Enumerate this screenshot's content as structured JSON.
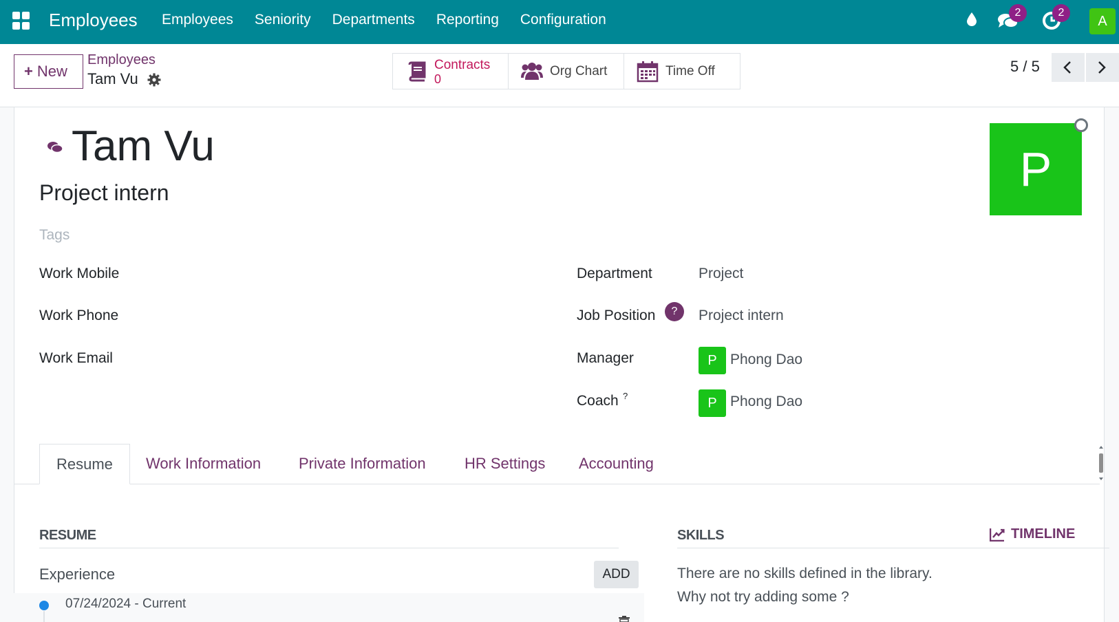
{
  "navbar": {
    "brand": "Employees",
    "menu": [
      "Employees",
      "Seniority",
      "Departments",
      "Reporting",
      "Configuration"
    ],
    "chat_badge": "2",
    "activity_badge": "2",
    "user_initial": "A",
    "color": "#008795"
  },
  "control": {
    "new_label": "New",
    "breadcrumb_parent": "Employees",
    "breadcrumb_current": "Tam Vu",
    "smart_buttons": {
      "contracts_label": "Contracts",
      "contracts_count": "0",
      "org_chart_label": "Org Chart",
      "time_off_label": "Time Off"
    },
    "pager": "5 / 5"
  },
  "employee": {
    "name": "Tam Vu",
    "job_title": "Project intern",
    "tags_placeholder": "Tags",
    "photo_initial": "P",
    "fields_left": {
      "work_mobile_label": "Work Mobile",
      "work_phone_label": "Work Phone",
      "work_email_label": "Work Email"
    },
    "fields_right": {
      "department_label": "Department",
      "department_value": "Project",
      "job_position_label": "Job Position",
      "job_position_help": "?",
      "job_position_value": "Project intern",
      "manager_label": "Manager",
      "manager_initial": "P",
      "manager_value": "Phong Dao",
      "coach_label": "Coach",
      "coach_help": "?",
      "coach_initial": "P",
      "coach_value": "Phong Dao"
    }
  },
  "tabs": [
    "Resume",
    "Work Information",
    "Private Information",
    "HR Settings",
    "Accounting"
  ],
  "resume": {
    "title": "RESUME",
    "experience_label": "Experience",
    "add_label": "ADD",
    "entry_date": "07/24/2024 - Current"
  },
  "skills": {
    "title": "SKILLS",
    "timeline_label": "TIMELINE",
    "empty_line1": "There are no skills defined in the library.",
    "empty_line2": "Why not try adding some ?"
  },
  "colors": {
    "accent": "#71346b",
    "avatar_green": "#19c419",
    "timeline_dot": "#1e88e5"
  }
}
